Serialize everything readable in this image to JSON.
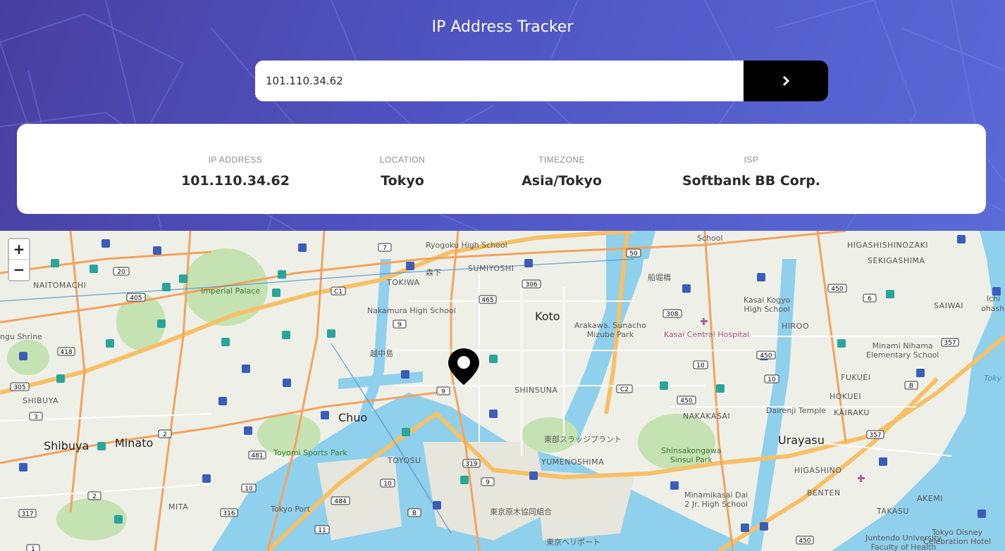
{
  "app": {
    "title": "IP Address Tracker"
  },
  "search": {
    "value": "101.110.34.62",
    "submit_icon": "chevron-right-icon"
  },
  "info": {
    "ip": {
      "label": "IP ADDRESS",
      "value": "101.110.34.62"
    },
    "location": {
      "label": "LOCATION",
      "value": "Tokyo"
    },
    "timezone": {
      "label": "TIMEZONE",
      "value": "Asia/Tokyo"
    },
    "isp": {
      "label": "ISP",
      "value": "Softbank BB Corp."
    }
  },
  "map": {
    "zoom_in": "+",
    "zoom_out": "−",
    "marker_icon": "location-pin-icon",
    "labels": {
      "koto": "Koto",
      "chuo": "Chuo",
      "shibuya": "Shibuya",
      "minato": "Minato",
      "urayasu": "Urayasu",
      "sumiyoshi": "SUMIYOSHI",
      "tokiwa": "TOKIWA",
      "shinsuna": "SHINSUNA",
      "yumenoshima": "YUMENOSHIMA",
      "toyosu": "TOYOSU",
      "naitomachi": "NAITOMACHI",
      "shibuya_area": "SHIBUYA",
      "mita": "MITA",
      "nakakasai": "NAKAKASAI",
      "hokuei": "HOKUEI",
      "kairaku": "KAIRAKU",
      "fukuei": "FUKUEI",
      "hiroo": "HIROO",
      "higashishinozaki": "HIGASHISHINOZAKI",
      "sekigashima": "SEKIGASHIMA",
      "saiwai": "SAIWAI",
      "benten": "BENTEN",
      "akemi": "AKEMI",
      "takasu": "TAKASU",
      "higashino": "HIGASHINO",
      "imperial_palace": "Imperial Palace",
      "ryogoku": "Ryogoku High School",
      "nakamura": "Nakamura High School",
      "kasai_kogyo": "Kasai Kogyo\nHigh School",
      "arakawa": "Arakawa. Sunacho\nMizube Park",
      "kasai_hospital": "Kasai Central Hospital",
      "minami_nihama": "Minami Nihama\nElementary School",
      "dairenji": "Dairenji Temple",
      "toyomi": "Toyomi Sports Park",
      "tokyo_port": "Tokyo Port",
      "shinsakongawa": "Shinsakongawa\nSinsui Park",
      "minamikasai": "Minamikasai Dai\n2 Jr. High School",
      "juntendo": "Juntendo University\nFaculty of Health",
      "disney": "Tokyo Disney\nCelebration Hotel",
      "shrine": "ngu Shrine",
      "school_top": "School",
      "morishita": "森下",
      "funabori": "船堀橋",
      "etchujima": "越中島",
      "sludge": "東部スラッジプラント",
      "kumiai": "東京原木協同組合",
      "heliport": "東京ヘリポート",
      "tokyo_bay": "Toky",
      "ohashi": "ohashi",
      "ichi": "Ichi"
    }
  },
  "colors": {
    "header_start": "#4a3fa0",
    "header_end": "#5a6ad6",
    "water": "#8fd0ec",
    "land": "#eef0e8",
    "park": "#c5e3b2",
    "road": "#f5a25d",
    "highway": "#f7c066",
    "rail": "#4b8ed1"
  }
}
